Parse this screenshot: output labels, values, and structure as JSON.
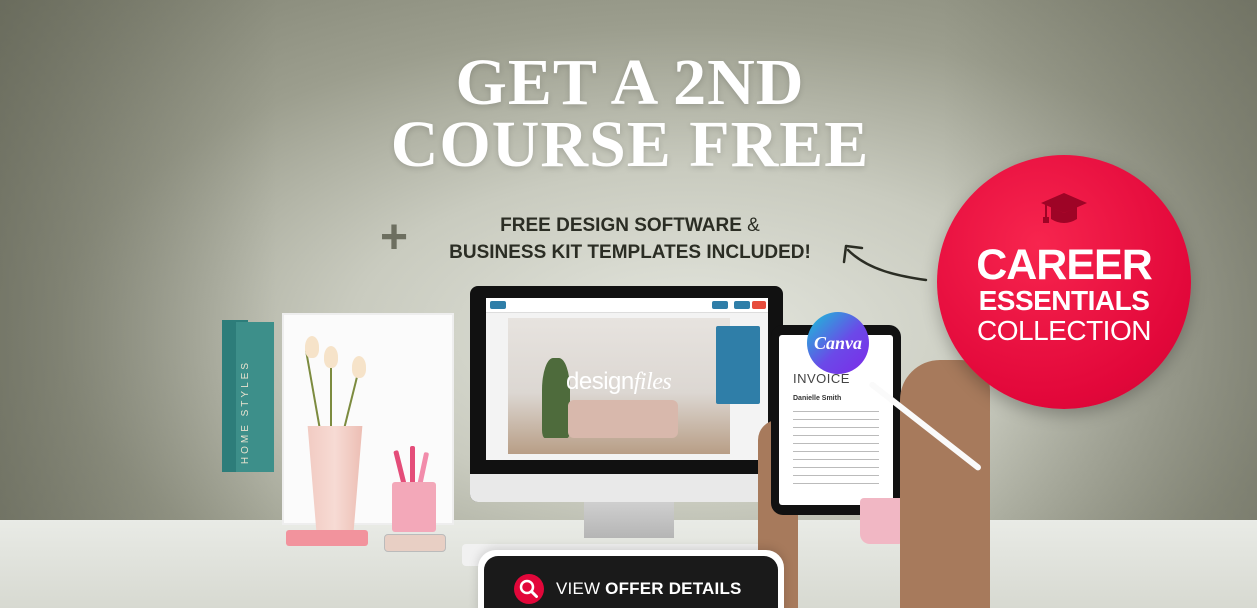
{
  "headline": {
    "line1": "GET A 2ND",
    "line2": "COURSE FREE"
  },
  "subline": {
    "plus": "+",
    "line1_bold": "FREE DESIGN SOFTWARE",
    "line1_light": " &",
    "line2_a": "BUSINESS KIT TEMPLATES",
    "line2_b": " INCLUDED!"
  },
  "badge": {
    "icon": "graduation-cap-icon",
    "line1": "CAREER",
    "line2": "ESSENTIALS",
    "line3": "COLLECTION",
    "color": "#e2073a"
  },
  "monitor": {
    "app_logo_a": "design",
    "app_logo_b": "files"
  },
  "tablet": {
    "badge_label": "Canva",
    "invoice_title": "INVOICE",
    "invoice_name": "Danielle Smith"
  },
  "books": {
    "spine_text": "HOME STYLES"
  },
  "cta": {
    "icon": "search-icon",
    "label_light": "VIEW ",
    "label_bold": "OFFER DETAILS"
  }
}
